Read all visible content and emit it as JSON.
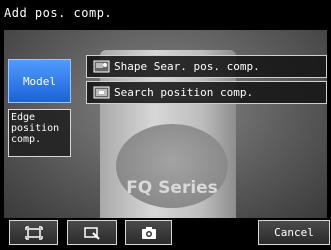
{
  "title": "Add pos. comp.",
  "side_items": {
    "model": "Model",
    "edge": "Edge\nposition\ncomp."
  },
  "menu": [
    {
      "label": "Shape Sear. pos. comp.",
      "icon": "shape-search-icon"
    },
    {
      "label": "Search position comp.",
      "icon": "search-position-icon"
    }
  ],
  "camera_view": {
    "label_text": "FQ Series"
  },
  "toolbar": {
    "fit_icon": "fit-to-screen-icon",
    "zoom_icon": "zoom-icon",
    "camera_icon": "camera-icon",
    "cancel_label": "Cancel"
  },
  "colors": {
    "selected_item": "#2f7df0",
    "background": "#000000",
    "border": "#d8d8d8"
  }
}
